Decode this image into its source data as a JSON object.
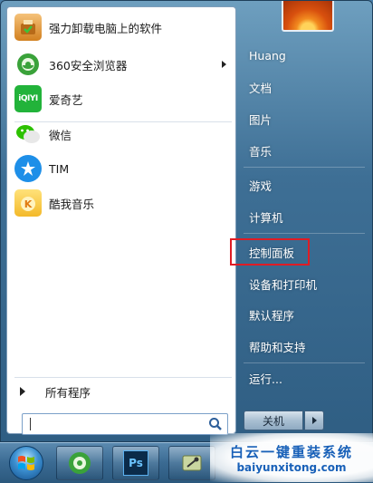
{
  "pinned_programs": [
    {
      "label": "强力卸载电脑上的软件",
      "icon": "uninstall-box-icon",
      "color": "#e08a2a",
      "has_submenu": false
    },
    {
      "label": "360安全浏览器",
      "icon": "360-browser-icon",
      "color": "#3aa23a",
      "has_submenu": true
    },
    {
      "label": "爱奇艺",
      "icon": "iqiyi-icon",
      "color": "#22b33a",
      "icon_text": "iQIYI",
      "has_submenu": false
    }
  ],
  "recent_programs": [
    {
      "label": "微信",
      "icon": "wechat-icon",
      "color": "#2dc100",
      "has_submenu": false
    },
    {
      "label": "TIM",
      "icon": "tim-icon",
      "color": "#1e8fe8",
      "has_submenu": false
    },
    {
      "label": "酷我音乐",
      "icon": "kuwo-music-icon",
      "color": "#f3b92a",
      "has_submenu": false
    }
  ],
  "all_programs_label": "所有程序",
  "search": {
    "placeholder": ""
  },
  "right_links": [
    {
      "label": "Huang"
    },
    {
      "label": "文档"
    },
    {
      "label": "图片"
    },
    {
      "label": "音乐"
    },
    {
      "label": "游戏"
    },
    {
      "label": "计算机"
    },
    {
      "label": "控制面板"
    },
    {
      "label": "设备和打印机"
    },
    {
      "label": "默认程序"
    },
    {
      "label": "帮助和支持"
    },
    {
      "label": "运行..."
    }
  ],
  "shutdown_label": "关机",
  "highlight_color": "#e01c24",
  "taskbar_items": [
    {
      "icon": "360-browser-icon"
    },
    {
      "icon": "photoshop-icon",
      "text": "Ps"
    },
    {
      "icon": "tool-icon"
    }
  ],
  "watermark": {
    "title": "白云一键重装系统",
    "url": "baiyunxitong.com"
  }
}
